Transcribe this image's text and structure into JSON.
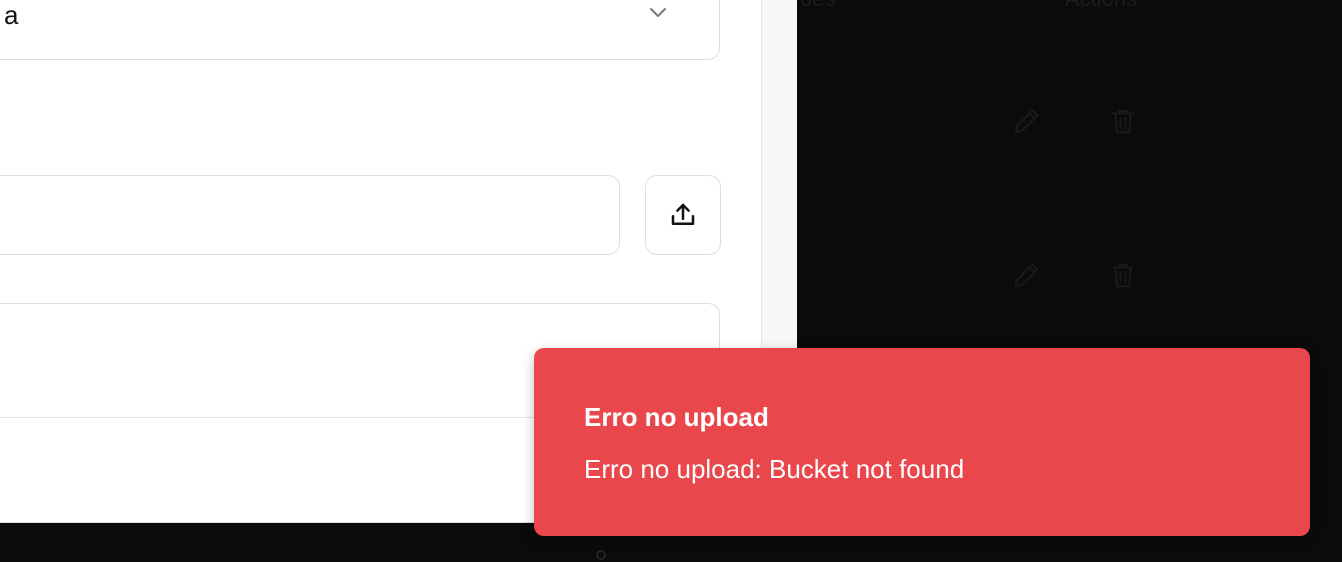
{
  "background_table": {
    "headers": [
      "ões",
      "Actions"
    ]
  },
  "modal": {
    "select_value": "a",
    "file_input_value": "",
    "textarea_value": ""
  },
  "toast": {
    "title": "Erro no upload",
    "message": "Erro no upload: Bucket not found",
    "color": "#ea474c"
  },
  "colors": {
    "modal_border": "#1f63c9",
    "backdrop": "#0b0b0b"
  }
}
